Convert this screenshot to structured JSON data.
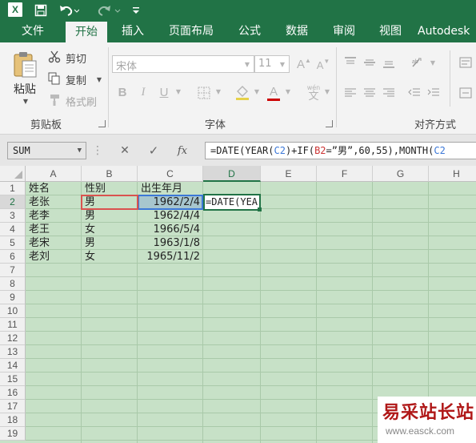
{
  "app": {
    "logo": "X",
    "brand_color": "#217346"
  },
  "quick_access": {
    "save_icon": "save-icon",
    "undo_icon": "undo-icon",
    "redo_icon": "redo-icon",
    "more_icon": "customize-icon"
  },
  "tabs": [
    "文件",
    "开始",
    "插入",
    "页面布局",
    "公式",
    "数据",
    "审阅",
    "视图",
    "Autodesk"
  ],
  "active_tab": "开始",
  "ribbon": {
    "clipboard": {
      "paste": "粘贴",
      "cut": "剪切",
      "copy": "复制",
      "format_painter": "格式刷",
      "group": "剪贴板"
    },
    "font": {
      "font_name": "宋体",
      "font_size": "11",
      "bold": "B",
      "italic": "I",
      "underline": "U",
      "font_color_letter": "A",
      "wen": "wén",
      "group": "字体"
    },
    "alignment": {
      "group": "对齐方式"
    }
  },
  "formula_bar": {
    "name_box": "SUM",
    "cancel": "✕",
    "enter": "✓",
    "fx": "fx",
    "parts": [
      "=DATE(YEAR(",
      "C2",
      ")+IF(",
      "B2",
      "=”男”,60,55),MONTH(",
      "C2"
    ]
  },
  "grid": {
    "columns": [
      "A",
      "B",
      "C",
      "D",
      "E",
      "F",
      "G",
      "H"
    ],
    "active_column": "D",
    "rows": [
      "1",
      "2",
      "3",
      "4",
      "5",
      "6",
      "7",
      "8",
      "9",
      "10",
      "11",
      "12",
      "13",
      "14",
      "15",
      "16",
      "17",
      "18",
      "19"
    ],
    "active_row": "2",
    "header": {
      "a": "姓名",
      "b": "性别",
      "c": "出生年月"
    },
    "data": [
      {
        "a": "老张",
        "b": "男",
        "c": "1962/2/4"
      },
      {
        "a": "老李",
        "b": "男",
        "c": "1962/4/4"
      },
      {
        "a": "老王",
        "b": "女",
        "c": "1966/5/4"
      },
      {
        "a": "老宋",
        "b": "男",
        "c": "1963/1/8"
      },
      {
        "a": "老刘",
        "b": "女",
        "c": "1965/11/2"
      }
    ],
    "editing_text": "=DATE(YEA"
  },
  "watermark": {
    "title": "易采站长站",
    "url": "www.easck.com"
  }
}
